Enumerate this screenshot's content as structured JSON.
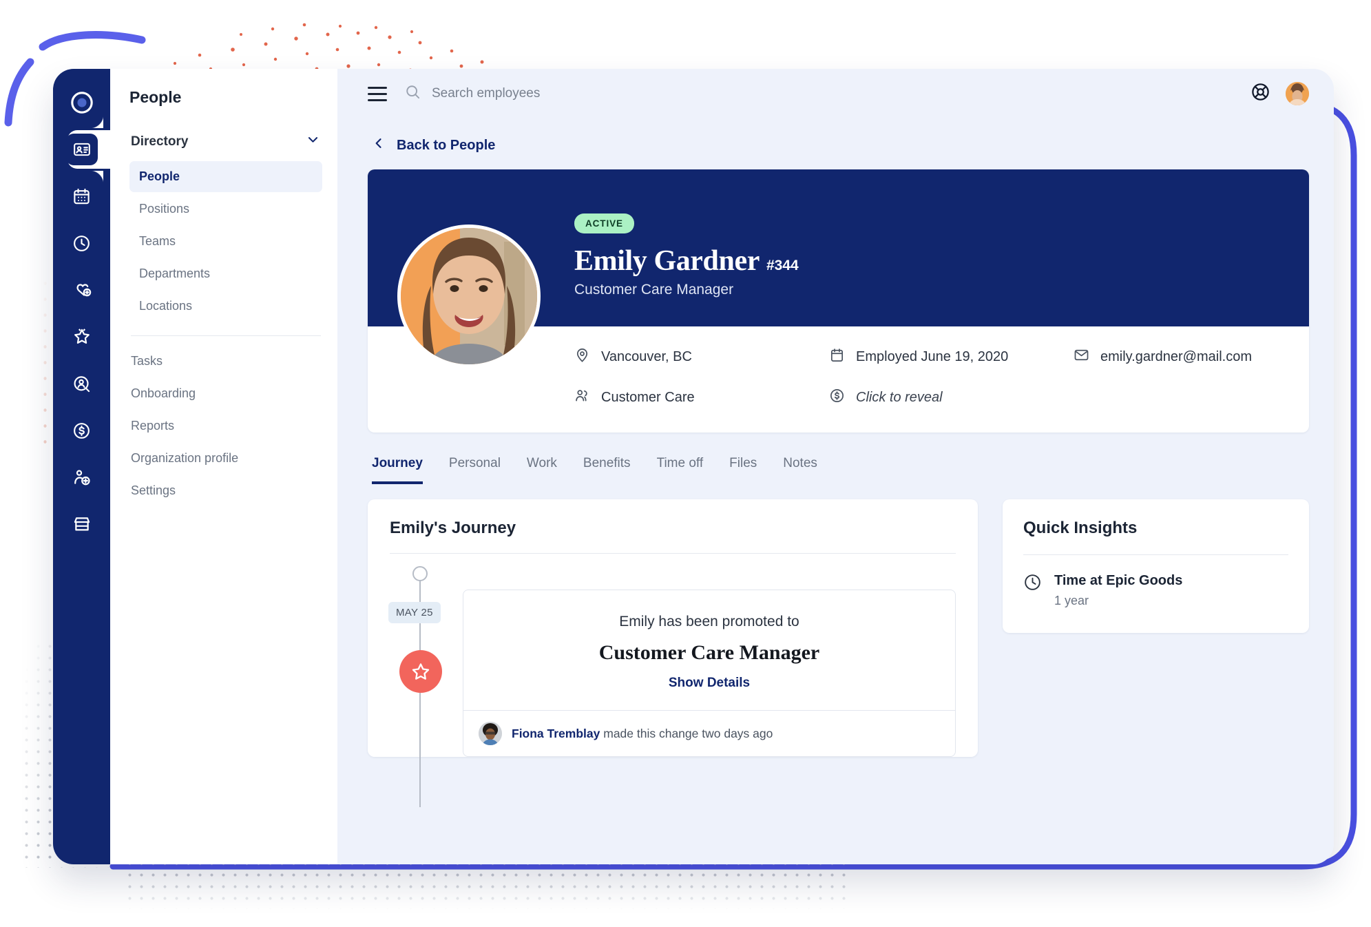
{
  "colors": {
    "navy": "#11266e",
    "panel_bg": "#eef2fb",
    "accent_blue": "#4a50e2",
    "coral": "#f2655c",
    "active_badge_bg": "#abf1c4",
    "avatar_orange": "#f2a055"
  },
  "rail": {
    "items": [
      {
        "icon": "logo-icon",
        "name": "logo"
      },
      {
        "icon": "id-card-icon",
        "name": "people",
        "active": true
      },
      {
        "icon": "calendar-icon",
        "name": "calendar"
      },
      {
        "icon": "clock-icon",
        "name": "time"
      },
      {
        "icon": "heart-plus-icon",
        "name": "benefits"
      },
      {
        "icon": "star-badge-icon",
        "name": "performance"
      },
      {
        "icon": "user-search-icon",
        "name": "recruiting"
      },
      {
        "icon": "dollar-circle-icon",
        "name": "payroll"
      },
      {
        "icon": "user-add-icon",
        "name": "onboarding"
      },
      {
        "icon": "store-icon",
        "name": "marketplace"
      }
    ]
  },
  "nav": {
    "title": "People",
    "section_label": "Directory",
    "section_icon": "chevron-down-icon",
    "directory_items": [
      {
        "label": "People",
        "selected": true
      },
      {
        "label": "Positions",
        "selected": false
      },
      {
        "label": "Teams",
        "selected": false
      },
      {
        "label": "Departments",
        "selected": false
      },
      {
        "label": "Locations",
        "selected": false
      }
    ],
    "other_items": [
      {
        "label": "Tasks"
      },
      {
        "label": "Onboarding"
      },
      {
        "label": "Reports"
      },
      {
        "label": "Organization profile"
      },
      {
        "label": "Settings"
      }
    ]
  },
  "topbar": {
    "menu_icon": "hamburger-icon",
    "search_icon": "search-icon",
    "search_placeholder": "Search employees",
    "search_value": "",
    "help_icon": "lifebuoy-icon",
    "avatar_icon": "user-avatar"
  },
  "back_link": {
    "icon": "chevron-left-icon",
    "label": "Back to People"
  },
  "profile": {
    "status_badge": "ACTIVE",
    "name": "Emily Gardner",
    "employee_id": "#344",
    "job_title": "Customer Care Manager",
    "meta": [
      {
        "icon": "location-pin-icon",
        "text": "Vancouver, BC",
        "italic": false
      },
      {
        "icon": "calendar-icon",
        "text": "Employed June 19, 2020",
        "italic": false
      },
      {
        "icon": "envelope-icon",
        "text": "emily.gardner@mail.com",
        "italic": false
      },
      {
        "icon": "people-icon",
        "text": "Customer Care",
        "italic": false
      },
      {
        "icon": "dollar-circle-icon",
        "text": "Click to reveal",
        "italic": true
      }
    ]
  },
  "tabs": [
    {
      "label": "Journey",
      "active": true
    },
    {
      "label": "Personal",
      "active": false
    },
    {
      "label": "Work",
      "active": false
    },
    {
      "label": "Benefits",
      "active": false
    },
    {
      "label": "Time off",
      "active": false
    },
    {
      "label": "Files",
      "active": false
    },
    {
      "label": "Notes",
      "active": false
    }
  ],
  "journey": {
    "title": "Emily's Journey",
    "event": {
      "date_badge": "MAY 25",
      "marker_icon": "star-icon",
      "lead_text": "Emily has been promoted to",
      "role": "Customer Care Manager",
      "details_link": "Show Details",
      "author": "Fiona Tremblay",
      "footer_text": " made this change two days ago"
    }
  },
  "insights": {
    "title": "Quick Insights",
    "items": [
      {
        "icon": "clock-icon",
        "label": "Time at Epic Goods",
        "value": "1 year"
      }
    ]
  }
}
